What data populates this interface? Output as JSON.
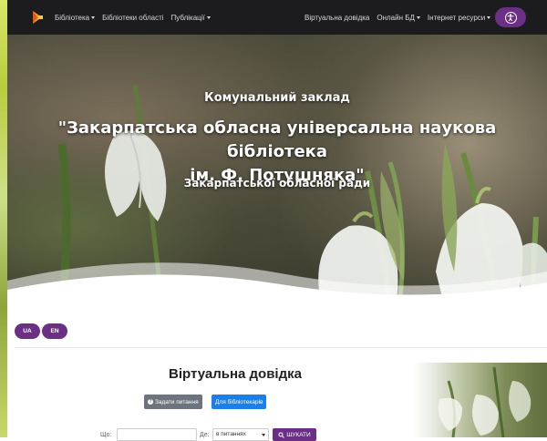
{
  "nav": {
    "left_items": [
      {
        "label": "Бібліотека",
        "has_dropdown": true
      },
      {
        "label": "Бібліотеки області",
        "has_dropdown": false
      },
      {
        "label": "Публікації",
        "has_dropdown": true
      }
    ],
    "right_items": [
      {
        "label": "Віртуальна довідка",
        "has_dropdown": false
      },
      {
        "label": "Онлайн БД",
        "has_dropdown": true
      },
      {
        "label": "Інтернет ресурси",
        "has_dropdown": true
      }
    ],
    "accessibility_icon": "accessibility-icon",
    "logo_icon": "library-logo-icon"
  },
  "hero": {
    "subtitle": "Комунальний заклад",
    "title_line1": "\"Закарпатська обласна універсальна наукова бібліотека",
    "title_line2": "ім. Ф. Потушняка\"",
    "subtitle2": "Закарпатської обласної ради"
  },
  "languages": [
    "UA",
    "EN"
  ],
  "virtual_reference": {
    "title": "Віртуальна довідка",
    "ask_button": "Задати питання",
    "librarians_button": "Для бібліотекарів",
    "search": {
      "what_label": "Що:",
      "where_label": "Де:",
      "where_selected": "в питаннях",
      "search_button": "ШУКАТИ"
    }
  },
  "colors": {
    "accent_purple": "#6b2f86",
    "navbar_bg": "#1c1c1e",
    "primary_blue": "#1a7fe6",
    "secondary_gray": "#6c757d"
  }
}
